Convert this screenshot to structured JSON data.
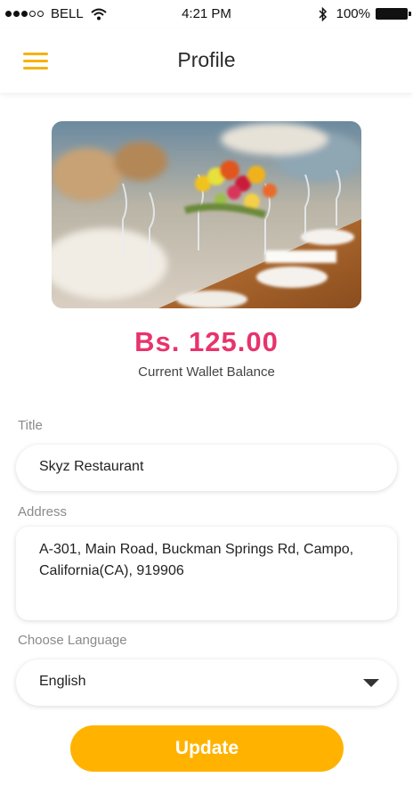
{
  "status_bar": {
    "carrier": "BELL",
    "time": "4:21 PM",
    "battery": "100%"
  },
  "header": {
    "title": "Profile",
    "menu_icon": "hamburger-menu-icon"
  },
  "wallet": {
    "balance": "Bs. 125.00",
    "label": "Current Wallet Balance"
  },
  "form": {
    "title_label": "Title",
    "title_value": "Skyz Restaurant",
    "address_label": "Address",
    "address_value": "A-301, Main Road, Buckman Springs Rd, Campo, California(CA), 919906",
    "language_label": "Choose Language",
    "language_value": "English"
  },
  "actions": {
    "update_label": "Update"
  },
  "colors": {
    "accent": "#ffb300",
    "balance": "#e8336b"
  }
}
